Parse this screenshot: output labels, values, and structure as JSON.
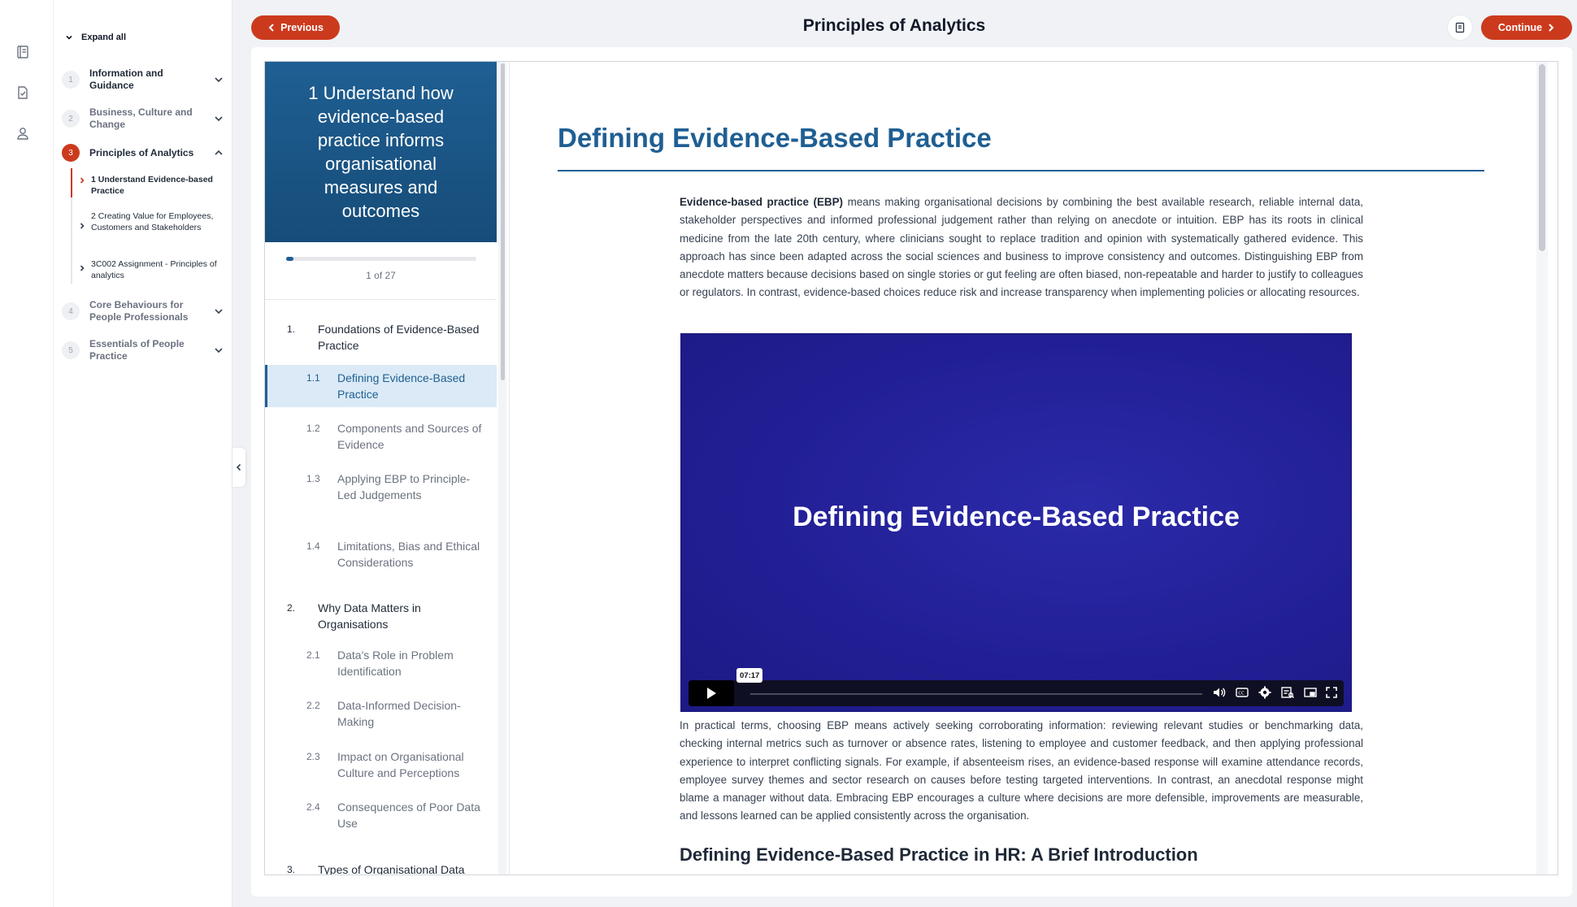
{
  "header": {
    "title": "Principles of Analytics",
    "previous_label": "Previous",
    "continue_label": "Continue"
  },
  "outline": {
    "expand_all": "Expand all",
    "modules": [
      {
        "num": "1",
        "title": "Information and Guidance"
      },
      {
        "num": "2",
        "title": "Business, Culture and Change"
      },
      {
        "num": "3",
        "title": "Principles of Analytics"
      },
      {
        "num": "4",
        "title": "Core Behaviours for People Professionals"
      },
      {
        "num": "5",
        "title": "Essentials of People Practice"
      }
    ],
    "subitems": [
      {
        "title": "1 Understand Evidence-based Practice"
      },
      {
        "title": "2 Creating Value for Employees, Customers and Stakeholders"
      },
      {
        "title": "3C002 Assignment - Principles of analytics"
      }
    ]
  },
  "lesson_nav": {
    "heading": "1 Understand how evidence-based practice informs organisational measures and outcomes",
    "progress_text": "1 of 27",
    "progress": 0.037,
    "sections": [
      {
        "num": "1.",
        "title": "Foundations of Evidence-Based Practice"
      },
      {
        "num": "2.",
        "title": "Why Data Matters in Organisations"
      },
      {
        "num": "3.",
        "title": "Types of Organisational Data"
      }
    ],
    "items": [
      {
        "num": "1.1",
        "title": "Defining Evidence-Based Practice"
      },
      {
        "num": "1.2",
        "title": "Components and Sources of Evidence"
      },
      {
        "num": "1.3",
        "title": "Applying EBP to Principle-Led Judgements"
      },
      {
        "num": "1.4",
        "title": "Limitations, Bias and Ethical Considerations"
      },
      {
        "num": "2.1",
        "title": "Data's Role in Problem Identification"
      },
      {
        "num": "2.2",
        "title": "Data-Informed Decision-Making"
      },
      {
        "num": "2.3",
        "title": "Impact on Organisational Culture and Perceptions"
      },
      {
        "num": "2.4",
        "title": "Consequences of Poor Data Use"
      }
    ]
  },
  "article": {
    "title": "Defining Evidence-Based Practice",
    "para1_bold": "Evidence-based practice (EBP)",
    "para1_rest": " means making organisational decisions by combining the best available research, reliable internal data, stakeholder perspectives and informed professional judgement rather than relying on anecdote or intuition. EBP has its roots in clinical medicine from the late 20th century, where clinicians sought to replace tradition and opinion with systematically gathered evidence. This approach has since been adapted across the social sciences and business to improve consistency and outcomes. Distinguishing EBP from anecdote matters because decisions based on single stories or gut feeling are often biased, non-repeatable and harder to justify to colleagues or regulators. In contrast, evidence-based choices reduce risk and increase transparency when implementing policies or allocating resources.",
    "video_title": "Defining Evidence-Based Practice",
    "video_time": "07:17",
    "para2": "In practical terms, choosing EBP means actively seeking corroborating information: reviewing relevant studies or benchmarking data, checking internal metrics such as turnover or absence rates, listening to employee and customer feedback, and then applying professional experience to interpret conflicting signals. For example, if absenteeism rises, an evidence-based response will examine attendance records, employee survey themes and sector research on causes before testing targeted interventions. In contrast, an anecdotal response might blame a manager without data. Embracing EBP encourages a culture where decisions are more defensible, improvements are measurable, and lessons learned can be applied consistently across the organisation.",
    "subheading": "Defining Evidence-Based Practice in HR: A Brief Introduction"
  },
  "icons": {
    "rail": [
      "book-icon",
      "document-check-icon",
      "user-icon"
    ]
  },
  "colors": {
    "accent_red": "#cc3a1d",
    "primary_blue": "#1f5f93",
    "video_bg": "#221f96"
  }
}
